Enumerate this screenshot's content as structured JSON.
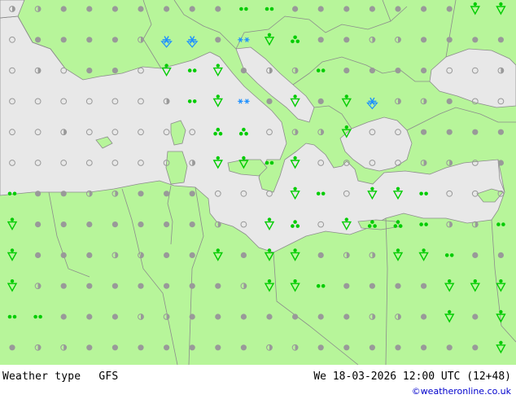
{
  "footer": {
    "label": "Weather type",
    "model": "GFS",
    "datetime": "We 18-03-2026 12:00 UTC (12+48)",
    "credit": "©weatheronline.co.uk"
  },
  "colors": {
    "land": "#b7f59a",
    "sea": "#e8e8e8",
    "border": "#8c8c8c",
    "dry_dot": "#999999",
    "rain": "#00cc00",
    "snow": "#1e90ff"
  },
  "symbol_legend": {
    "dot": "dry",
    "ring": "cloudy",
    "drizzle": "drizzle",
    "shower": "rain showers",
    "thunder": "thundery showers",
    "snow": "snow showers",
    "snowdots": "snow"
  },
  "grid": {
    "columns": 20,
    "rows": 12,
    "symbols": [
      "orrororro D Dooo ooo",
      "ooooo SS oS ooo ooor",
      "oooooo Doooooooorror",
      "ooooooooororooooooor",
      "ooooooooooorooooooor",
      "ooooooooororooooooor",
      "D ooooooooorooDooooo",
      "ooooooooooooooooooo",
      "oooooooooooooooooDoo",
      "ooooooooooooooooDo o",
      "DDoooooooooooooooooo",
      "oooooooooooooooooooo"
    ],
    "overrides": [
      {
        "r": 0,
        "c": 9,
        "s": "drizzle"
      },
      {
        "r": 0,
        "c": 10,
        "s": "drizzle"
      },
      {
        "r": 0,
        "c": 18,
        "s": "shower"
      },
      {
        "r": 0,
        "c": 19,
        "s": "shower"
      },
      {
        "r": 1,
        "c": 6,
        "s": "snow"
      },
      {
        "r": 1,
        "c": 7,
        "s": "snow"
      },
      {
        "r": 1,
        "c": 9,
        "s": "snowdots"
      },
      {
        "r": 1,
        "c": 10,
        "s": "shower"
      },
      {
        "r": 1,
        "c": 11,
        "s": "thunder"
      },
      {
        "r": 2,
        "c": 6,
        "s": "shower"
      },
      {
        "r": 2,
        "c": 7,
        "s": "drizzle"
      },
      {
        "r": 2,
        "c": 8,
        "s": "shower"
      },
      {
        "r": 2,
        "c": 12,
        "s": "drizzle"
      },
      {
        "r": 3,
        "c": 7,
        "s": "drizzle"
      },
      {
        "r": 3,
        "c": 8,
        "s": "shower"
      },
      {
        "r": 3,
        "c": 9,
        "s": "snowdots"
      },
      {
        "r": 3,
        "c": 11,
        "s": "shower"
      },
      {
        "r": 3,
        "c": 13,
        "s": "shower"
      },
      {
        "r": 3,
        "c": 14,
        "s": "snow"
      },
      {
        "r": 4,
        "c": 8,
        "s": "thunder"
      },
      {
        "r": 4,
        "c": 9,
        "s": "thunder"
      },
      {
        "r": 4,
        "c": 13,
        "s": "shower"
      },
      {
        "r": 5,
        "c": 8,
        "s": "shower"
      },
      {
        "r": 5,
        "c": 9,
        "s": "shower"
      },
      {
        "r": 5,
        "c": 10,
        "s": "drizzle"
      },
      {
        "r": 5,
        "c": 11,
        "s": "shower"
      },
      {
        "r": 6,
        "c": 0,
        "s": "drizzle"
      },
      {
        "r": 6,
        "c": 11,
        "s": "shower"
      },
      {
        "r": 6,
        "c": 12,
        "s": "drizzle"
      },
      {
        "r": 6,
        "c": 14,
        "s": "shower"
      },
      {
        "r": 6,
        "c": 15,
        "s": "shower"
      },
      {
        "r": 6,
        "c": 16,
        "s": "drizzle"
      },
      {
        "r": 7,
        "c": 0,
        "s": "shower"
      },
      {
        "r": 7,
        "c": 10,
        "s": "shower"
      },
      {
        "r": 7,
        "c": 11,
        "s": "thunder"
      },
      {
        "r": 7,
        "c": 13,
        "s": "shower"
      },
      {
        "r": 7,
        "c": 14,
        "s": "thunder"
      },
      {
        "r": 7,
        "c": 15,
        "s": "thunder"
      },
      {
        "r": 7,
        "c": 16,
        "s": "drizzle"
      },
      {
        "r": 7,
        "c": 19,
        "s": "drizzle"
      },
      {
        "r": 8,
        "c": 0,
        "s": "shower"
      },
      {
        "r": 8,
        "c": 8,
        "s": "shower"
      },
      {
        "r": 8,
        "c": 10,
        "s": "shower"
      },
      {
        "r": 8,
        "c": 11,
        "s": "shower"
      },
      {
        "r": 8,
        "c": 15,
        "s": "shower"
      },
      {
        "r": 8,
        "c": 16,
        "s": "shower"
      },
      {
        "r": 8,
        "c": 17,
        "s": "drizzle"
      },
      {
        "r": 9,
        "c": 0,
        "s": "shower"
      },
      {
        "r": 9,
        "c": 10,
        "s": "shower"
      },
      {
        "r": 9,
        "c": 11,
        "s": "shower"
      },
      {
        "r": 9,
        "c": 12,
        "s": "drizzle"
      },
      {
        "r": 9,
        "c": 17,
        "s": "shower"
      },
      {
        "r": 9,
        "c": 18,
        "s": "shower"
      },
      {
        "r": 9,
        "c": 19,
        "s": "shower"
      },
      {
        "r": 10,
        "c": 0,
        "s": "drizzle"
      },
      {
        "r": 10,
        "c": 1,
        "s": "drizzle"
      },
      {
        "r": 10,
        "c": 17,
        "s": "shower"
      },
      {
        "r": 10,
        "c": 19,
        "s": "shower"
      },
      {
        "r": 11,
        "c": 19,
        "s": "shower"
      }
    ]
  }
}
